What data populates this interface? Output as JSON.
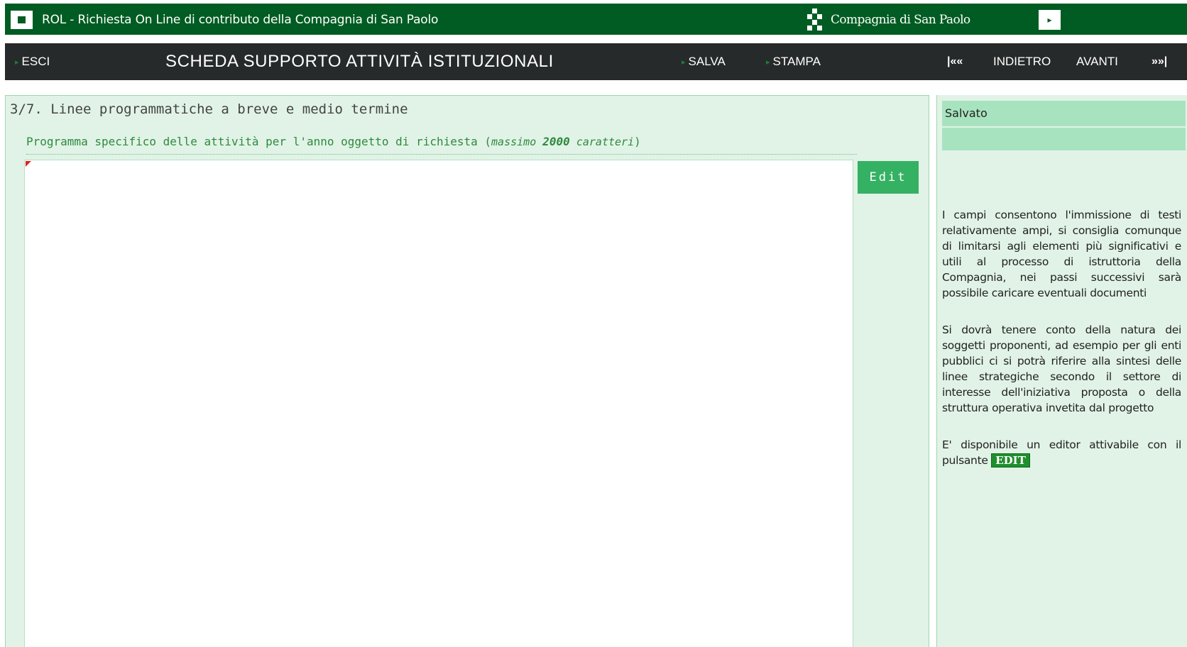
{
  "titlebar": {
    "app_title": "ROL - Richiesta On Line di contributo della Compagnia di San Paolo",
    "brand_name": "Compagnia di San Paolo",
    "background": "#005c22"
  },
  "toolbar": {
    "exit_label": "ESCI",
    "page_title": "SCHEDA SUPPORTO ATTIVITÀ ISTITUZIONALI",
    "save_label": "SALVA",
    "print_label": "STAMPA",
    "first_label": "|««",
    "back_label": "INDIETRO",
    "next_label": "AVANTI",
    "last_label": "»»|",
    "background": "#272a2a"
  },
  "main": {
    "section_title": "3/7. Linee programmatiche a breve e medio termine",
    "field_label": "Programma specifico delle attività per l'anno oggetto di richiesta (",
    "field_limit_prefix": "massimo ",
    "field_limit_value": "2000",
    "field_limit_suffix": " caratteri",
    "field_label_close": ")",
    "field_value": "",
    "edit_button_label": "Edit"
  },
  "info": {
    "status": "Salvato",
    "status_detail": "",
    "help_1": "I campi consentono l'immissione di testi relativamente ampi, si consiglia comunque di limitarsi agli elementi più significativi e utili al processo di istruttoria della Compagnia, nei passi successivi sarà possibile caricare eventuali documenti",
    "help_2": "Si dovrà tenere conto della natura dei soggetti proponenti, ad esempio per gli enti pubblici ci si potrà riferire alla sintesi delle linee strategiche secondo il settore di interesse dell'iniziativa proposta o della struttura operativa invetita dal progetto",
    "help_3": "E' disponibile un editor attivabile con il pulsante",
    "help_3_badge": "EDIT"
  },
  "colors": {
    "accent_green": "#35b163",
    "panel_background": "#e1f3e6",
    "status_background": "#a8e3c0"
  }
}
